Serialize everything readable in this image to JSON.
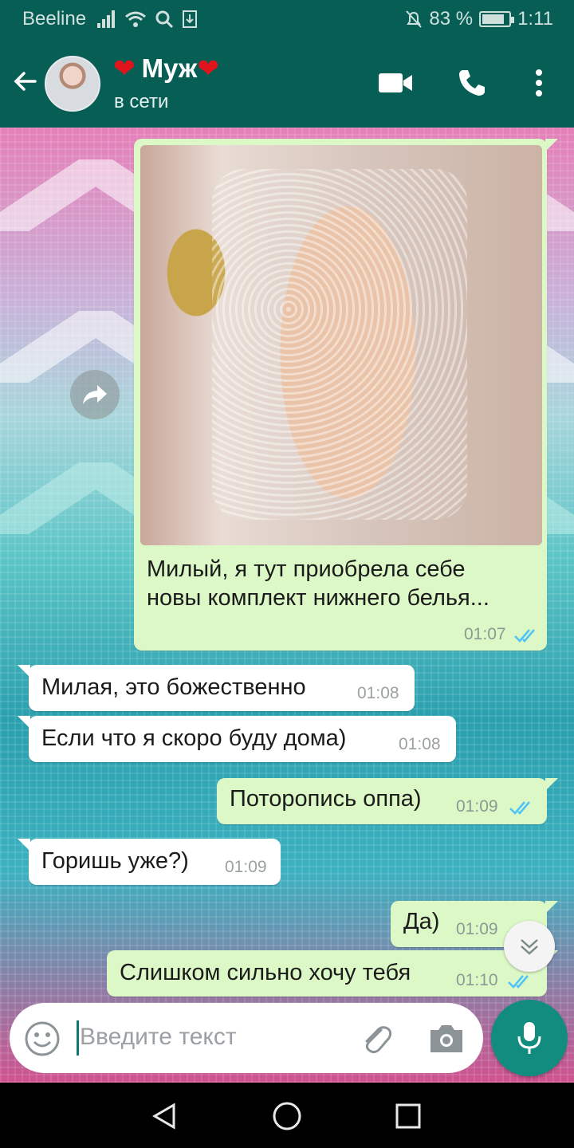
{
  "status_bar": {
    "carrier": "Beeline",
    "battery": "83 %",
    "battery_level": 0.83,
    "time": "1:11"
  },
  "header": {
    "contact_name_heart_left": "❤",
    "contact_name": "Муж",
    "contact_name_heart_right": "❤",
    "status": "в сети",
    "icons": [
      "back-arrow-icon",
      "video-call-icon",
      "phone-icon",
      "more-vert-icon"
    ]
  },
  "messages": [
    {
      "dir": "out",
      "type": "image",
      "text": "Милый, я тут приобрела себе новы комплект нижнего белья...",
      "time": "01:07",
      "read": true
    },
    {
      "dir": "in",
      "text": "Милая, это божественно",
      "time": "01:08"
    },
    {
      "dir": "in",
      "text": "Если что я скоро буду дома)",
      "time": "01:08"
    },
    {
      "dir": "out",
      "text": "Поторопись оппа)",
      "time": "01:09",
      "read": true
    },
    {
      "dir": "in",
      "text": "Горишь уже?)",
      "time": "01:09"
    },
    {
      "dir": "out",
      "text": "Да)",
      "time": "01:09",
      "read": true
    },
    {
      "dir": "out",
      "text": "Слишком сильно хочу тебя",
      "time": "01:10",
      "read": true
    }
  ],
  "composer": {
    "placeholder": "Введите текст",
    "icons": [
      "emoji-icon",
      "attach-icon",
      "camera-icon",
      "mic-icon"
    ]
  },
  "colors": {
    "header": "#075e54",
    "out_bubble": "#dcf8c6",
    "in_bubble": "#ffffff",
    "tick_read": "#4fc3f7",
    "mic_button": "#128c7e"
  }
}
